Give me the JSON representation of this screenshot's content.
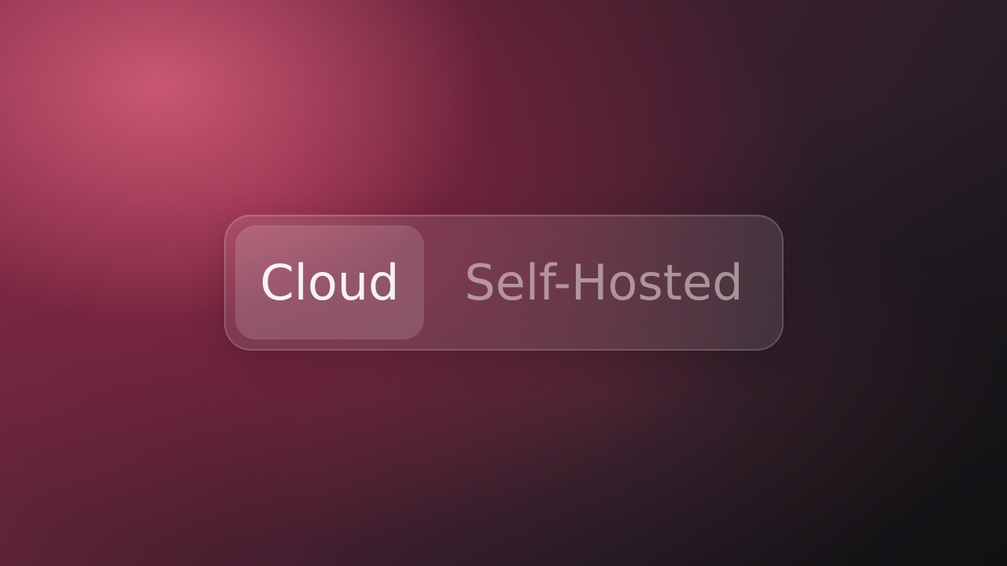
{
  "segmented_control": {
    "options": [
      {
        "label": "Cloud",
        "selected": true
      },
      {
        "label": "Self-Hosted",
        "selected": false
      }
    ]
  }
}
